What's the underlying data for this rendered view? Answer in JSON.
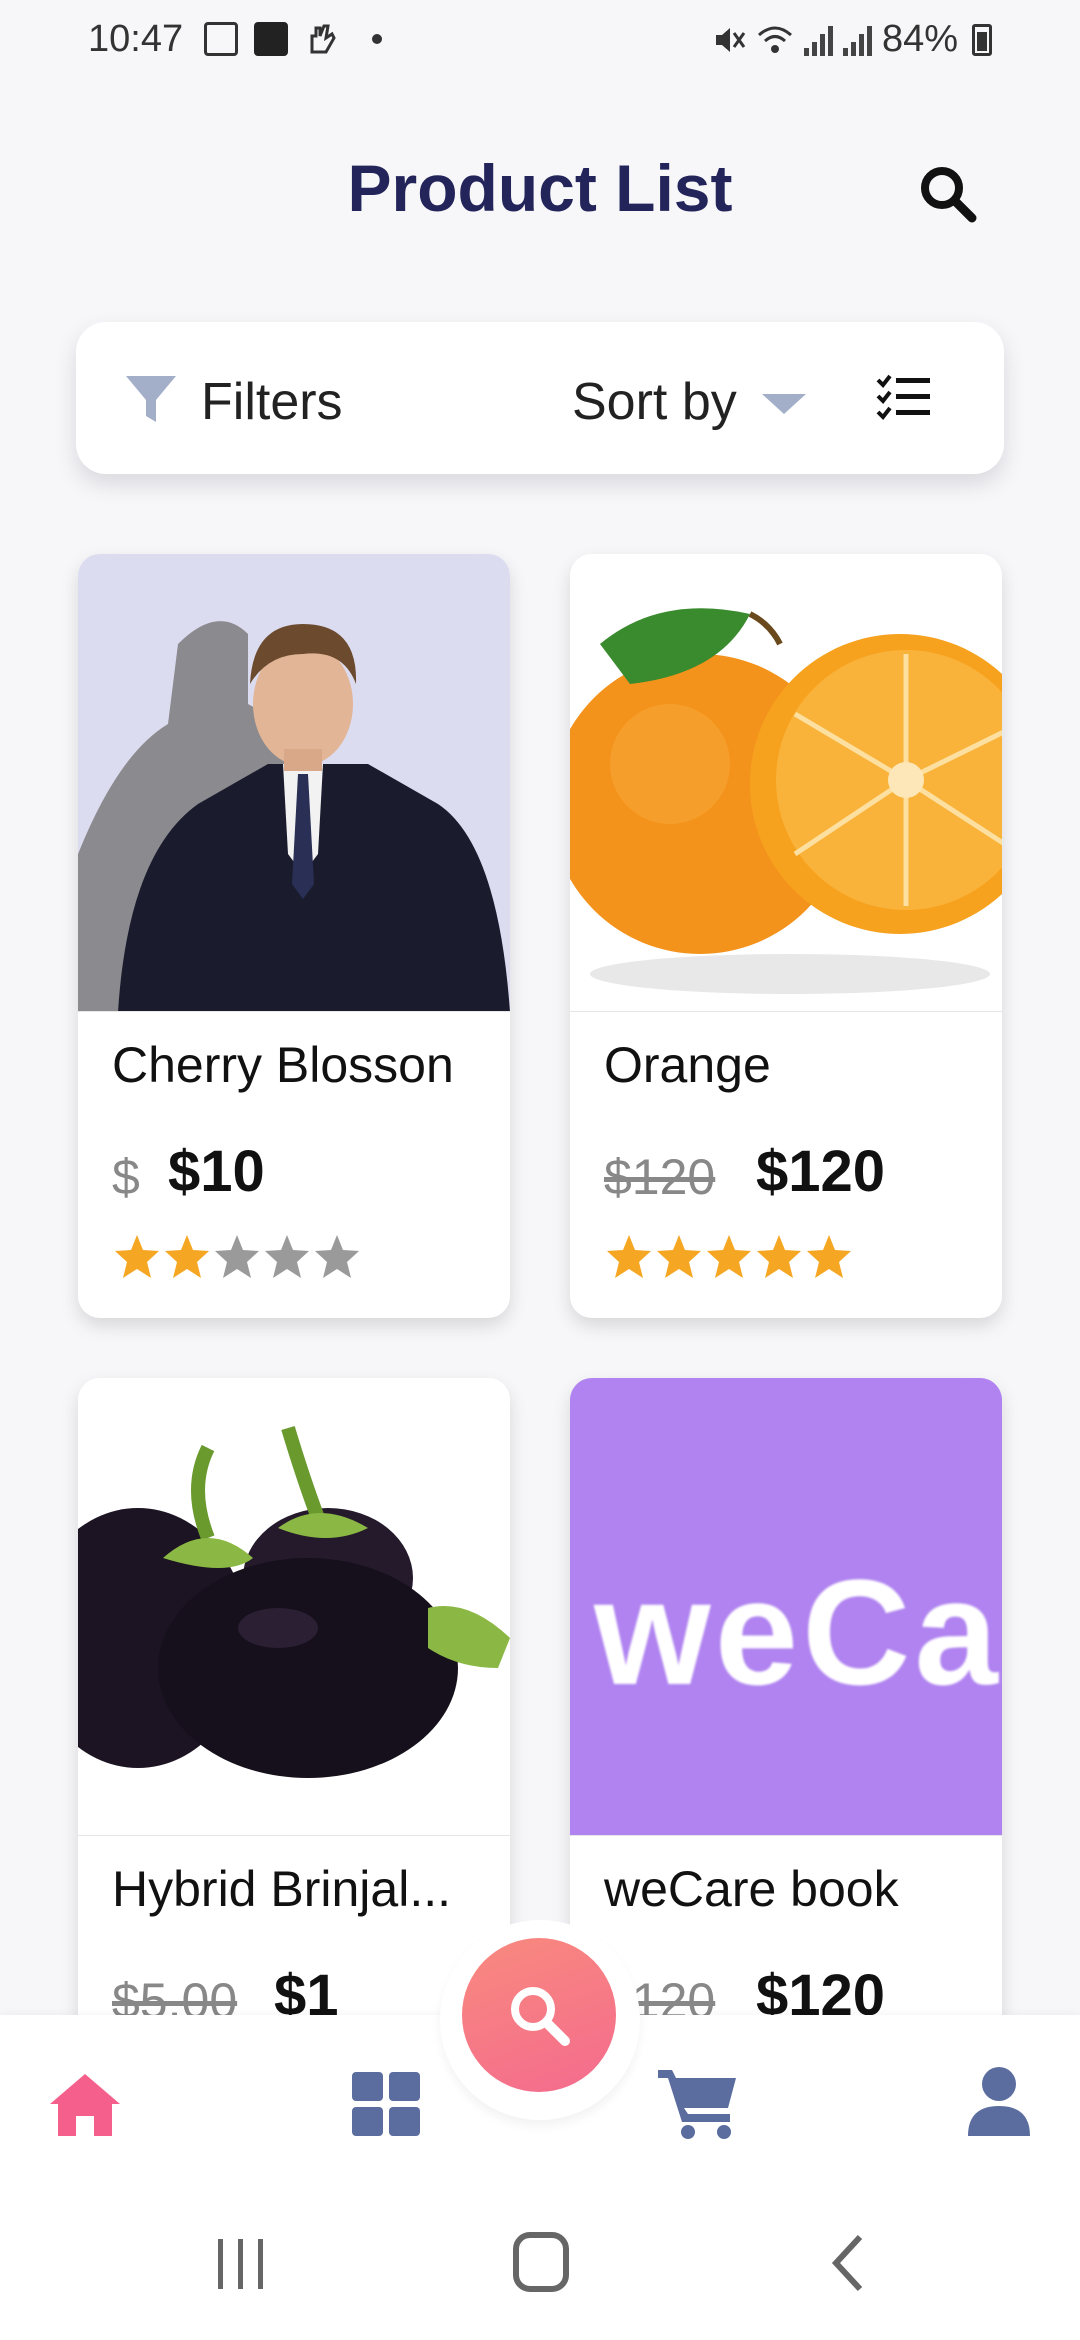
{
  "status_bar": {
    "time": "10:47",
    "battery": "84%"
  },
  "header": {
    "title": "Product List"
  },
  "toolbar": {
    "filters_label": "Filters",
    "sort_label": "Sort by"
  },
  "products": [
    {
      "name": "Cherry Blosson",
      "old_price": "$",
      "price": "$10",
      "rating": 2
    },
    {
      "name": "Orange",
      "old_price": "$120",
      "price": "$120",
      "rating": 5
    },
    {
      "name": "Hybrid Brinjal...",
      "old_price": "$5.00",
      "price": "$1",
      "rating": 0
    },
    {
      "name": "weCare book",
      "old_price": "$120",
      "price": "$120",
      "rating": 0,
      "image_text": "weCa"
    }
  ],
  "bottom_nav": {
    "items": [
      "home-icon",
      "grid-icon",
      "cart-icon",
      "profile-icon"
    ],
    "fab": "search-icon",
    "active_color": "#f55f8c",
    "inactive_color": "#5a6d9e"
  },
  "colors": {
    "title": "#22245a",
    "star_active": "#f5a623",
    "star_inactive": "#9a9a9a",
    "book_bg": "#b083f0"
  }
}
